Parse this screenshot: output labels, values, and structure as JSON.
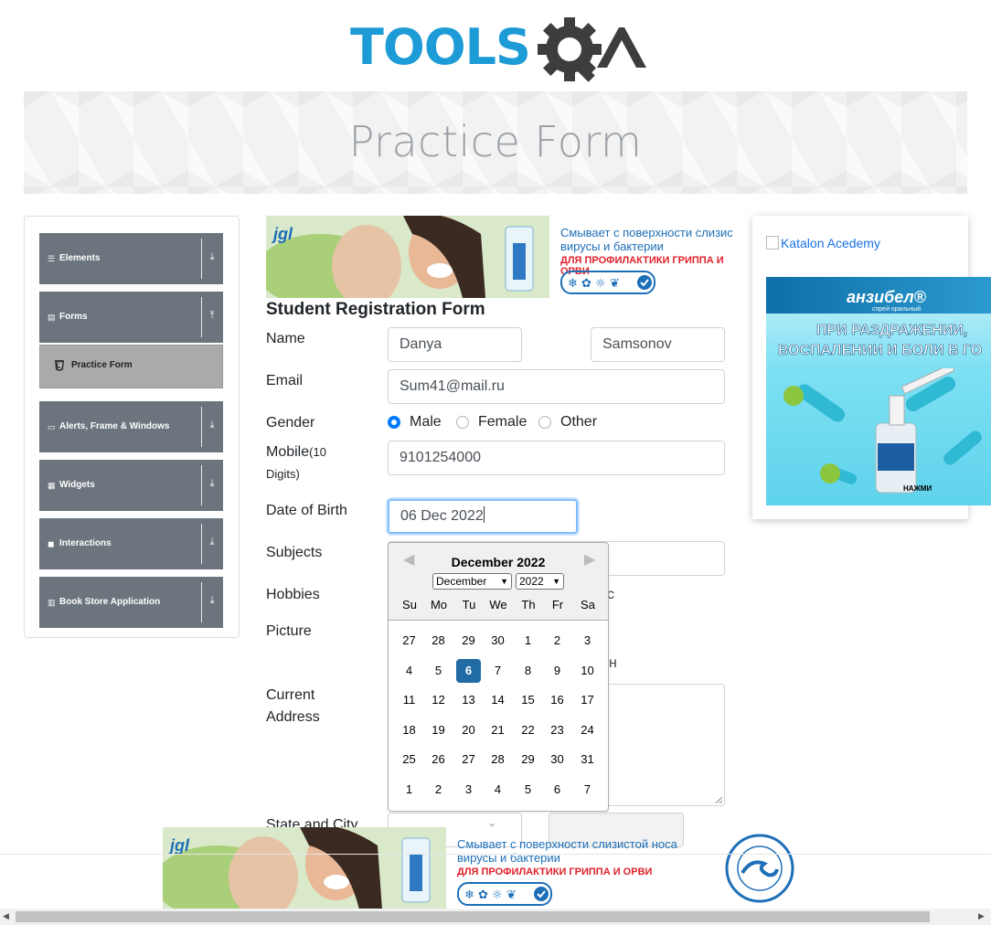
{
  "header": {
    "logo_text": "TOOLSQA",
    "banner_title": "Practice Form"
  },
  "nav": {
    "groups": [
      {
        "label": "Elements",
        "icon": "menu-icon"
      },
      {
        "label": "Forms",
        "icon": "form-icon"
      },
      {
        "label": "Alerts, Frame & Windows",
        "icon": "window-icon"
      },
      {
        "label": "Widgets",
        "icon": "widgets-icon"
      },
      {
        "label": "Interactions",
        "icon": "interactions-icon"
      },
      {
        "label": "Book Store Application",
        "icon": "book-icon"
      }
    ],
    "active_item": "Practice Form"
  },
  "ads": {
    "top_line1": "Смывает с поверхности слизис",
    "top_line2": "вирусы и бактерии",
    "top_line3": "ДЛЯ ПРОФИЛАКТИКИ ГРИППА И ОРВИ",
    "bottom_line1": "Смывает с поверхности слизистой носа",
    "bottom_line2": "вирусы и бактерии",
    "bottom_line3": "ДЛЯ ПРОФИЛАКТИКИ ГРИППА И ОРВИ",
    "right_link": "Katalon Acedemy",
    "anz_brand": "анзибел®",
    "anz_sub": "спрей оральный",
    "anz_line1": "ПРИ РАЗДРАЖЕНИИ,",
    "anz_line2": "ВОСПАЛЕНИИ И БОЛИ В ГО",
    "anz_cta": "НАЖМИ"
  },
  "form": {
    "title": "Student Registration Form",
    "name_label": "Name",
    "first_name": "Danya",
    "last_name": "Samsonov",
    "email_label": "Email",
    "email": "Sum41@mail.ru",
    "gender_label": "Gender",
    "gender_options": [
      "Male",
      "Female",
      "Other"
    ],
    "gender_selected": "Male",
    "mobile_label": "Mobile",
    "mobile_hint": "(10",
    "mobile_hint2": "Digits)",
    "mobile": "9101254000",
    "dob_label": "Date of Birth",
    "dob": "06 Dec 2022",
    "subjects_label": "Subjects",
    "hobbies_label": "Hobbies",
    "hobbies_partial": "c",
    "picture_label": "Picture",
    "picture_partial": "н",
    "address_label1": "Current",
    "address_label2": "Address",
    "state_label": "State and City"
  },
  "datepicker": {
    "month_title": "December 2022",
    "month_select": "December",
    "year_select": "2022",
    "day_names": [
      "Su",
      "Mo",
      "Tu",
      "We",
      "Th",
      "Fr",
      "Sa"
    ],
    "weeks": [
      [
        "27",
        "28",
        "29",
        "30",
        "1",
        "2",
        "3"
      ],
      [
        "4",
        "5",
        "6",
        "7",
        "8",
        "9",
        "10"
      ],
      [
        "11",
        "12",
        "13",
        "14",
        "15",
        "16",
        "17"
      ],
      [
        "18",
        "19",
        "20",
        "21",
        "22",
        "23",
        "24"
      ],
      [
        "25",
        "26",
        "27",
        "28",
        "29",
        "30",
        "31"
      ],
      [
        "1",
        "2",
        "3",
        "4",
        "5",
        "6",
        "7"
      ]
    ],
    "selected_day": "6"
  },
  "colors": {
    "brand_blue": "#1d9bd6",
    "nav_gray": "#6c757d",
    "selected_day": "#216ba5"
  }
}
